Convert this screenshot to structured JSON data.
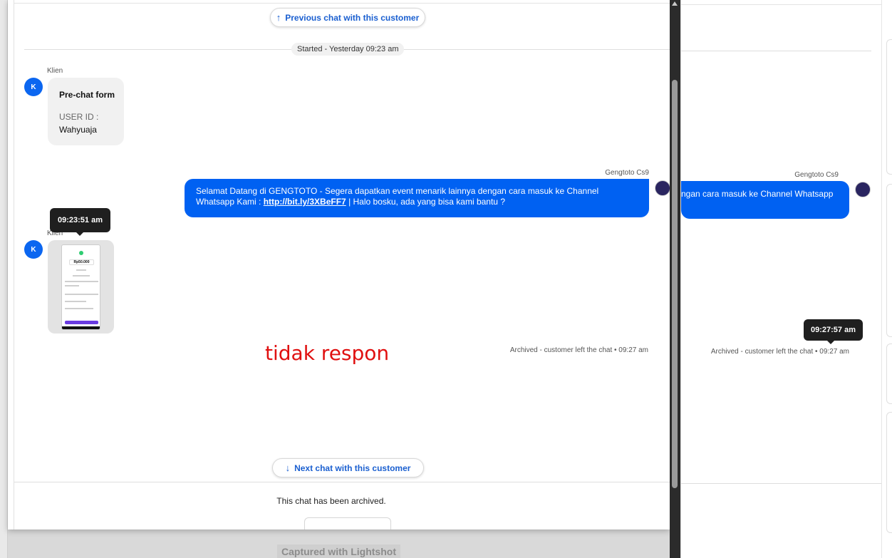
{
  "background_window": {
    "sender_name": "Gengtoto Cs9",
    "bubble_text": "ngan cara masuk ke Channel Whatsapp",
    "archived_text": "Archived - customer left the chat",
    "archived_time": "09:27 am",
    "tooltip": "09:27:57 am",
    "avatar_icon": "gengtoto-logo-icon"
  },
  "chat": {
    "previous_button": "Previous chat with this customer",
    "next_button": "Next chat with this customer",
    "started_label": "Started - Yesterday 09:23 am",
    "messages": {
      "client_name": "Klien",
      "client_avatar": "K",
      "prechat": {
        "title": "Pre-chat form",
        "field_label": "USER ID :",
        "field_value": "Wahyuaja"
      },
      "agent_name": "Gengtoto Cs9",
      "agent_message_part1": "Selamat Datang di GENGTOTO - Segera dapatkan event menarik lainnya dengan cara masuk ke Channel Whatsapp Kami : ",
      "agent_link": "http://bit.ly/3XBeFF7",
      "agent_message_part2": " | Halo bosku, ada yang bisa kami bantu ?",
      "client_name_2": "Klien",
      "client_avatar_2": "K",
      "image_tooltip": "09:23:51 am",
      "screenshot_amount": "Rp50.000"
    },
    "annotation": "tidak respon",
    "archived_text": "Archived - customer left the chat",
    "archived_time": "09:27 am",
    "footer_text": "This chat has been archived."
  },
  "watermark": "Captured with Lightshot",
  "colors": {
    "agent_bubble": "#0061f2",
    "avatar": "#0b66f0",
    "link_button": "#1a5fd0",
    "annotation": "#e01010"
  }
}
